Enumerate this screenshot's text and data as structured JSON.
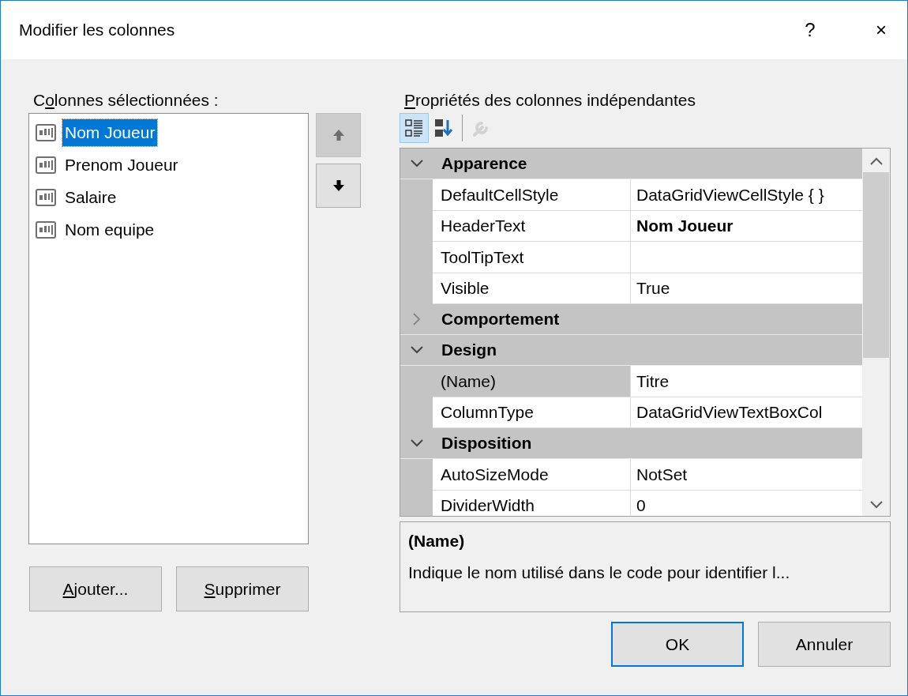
{
  "window": {
    "title": "Modifier les colonnes",
    "help_button": "?",
    "close_button": "×"
  },
  "columns_panel": {
    "label": {
      "pre": "C",
      "key": "o",
      "post": "lonnes sélectionnées :"
    },
    "items": [
      {
        "text": "Nom Joueur",
        "selected": true
      },
      {
        "text": "Prenom Joueur",
        "selected": false
      },
      {
        "text": "Salaire",
        "selected": false
      },
      {
        "text": "Nom equipe",
        "selected": false
      }
    ],
    "move_buttons": [
      {
        "kind": "up",
        "disabled": true
      },
      {
        "kind": "down",
        "disabled": false
      }
    ],
    "buttons": [
      {
        "key": "A",
        "post": "jouter..."
      },
      {
        "key": "S",
        "post": "upprimer"
      }
    ]
  },
  "properties_panel": {
    "label": {
      "key": "P",
      "post": "ropriétés des colonnes indépendantes"
    },
    "toolbar": [
      {
        "kind": "categorized",
        "selected": true,
        "disabled": false
      },
      {
        "kind": "alphabetical",
        "selected": false,
        "disabled": false
      },
      {
        "kind": "property-pages",
        "selected": false,
        "disabled": true
      }
    ],
    "categories": [
      {
        "name": "Apparence",
        "expanded": true,
        "rows": [
          {
            "name": "DefaultCellStyle",
            "value": "DataGridViewCellStyle { }",
            "selected": false
          },
          {
            "name": "HeaderText",
            "value": "Nom Joueur",
            "modified": true,
            "selected": false
          },
          {
            "name": "ToolTipText",
            "selected": false
          },
          {
            "name": "Visible",
            "value": "True",
            "selected": false
          }
        ]
      },
      {
        "name": "Comportement",
        "expanded": false
      },
      {
        "name": "Design",
        "expanded": true,
        "rows": [
          {
            "name": "(Name)",
            "value": "Titre",
            "selected": true
          },
          {
            "name": "ColumnType",
            "value": "DataGridViewTextBoxCol",
            "selected": false
          }
        ]
      },
      {
        "name": "Disposition",
        "expanded": true,
        "rows": [
          {
            "name": "AutoSizeMode",
            "value": "NotSet",
            "selected": false
          },
          {
            "name": "DividerWidth",
            "value": "0",
            "selected": false
          }
        ]
      }
    ],
    "description": {
      "title": "(Name)",
      "text": "Indique le nom utilisé dans le code pour identifier l..."
    }
  },
  "dialog_buttons": [
    {
      "text": "OK",
      "default": true
    },
    {
      "text": "Annuler",
      "default": false
    }
  ]
}
